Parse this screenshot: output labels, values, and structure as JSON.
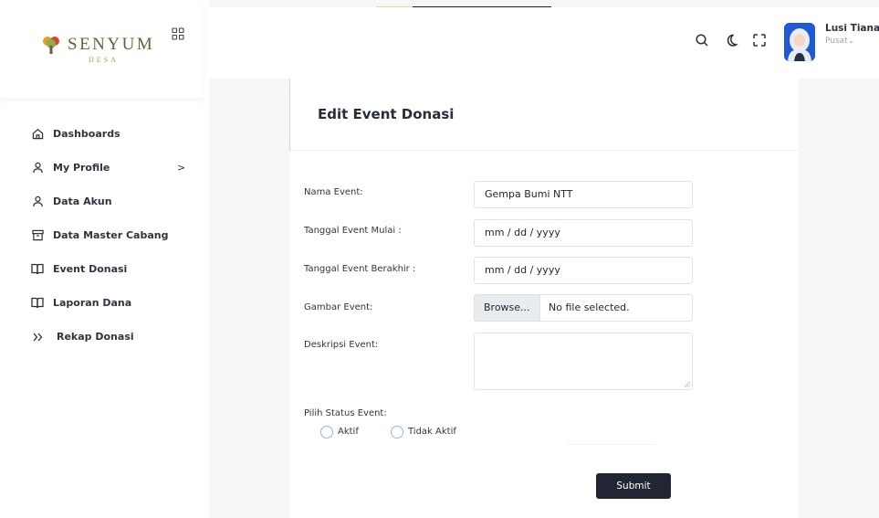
{
  "brand": {
    "name": "SENYUM",
    "tagline": "DESA"
  },
  "sidebar": {
    "items": [
      {
        "label": "Dashboards",
        "icon": "home-icon"
      },
      {
        "label": "My Profile",
        "icon": "user-icon",
        "chevron": ">"
      },
      {
        "label": "Data Akun",
        "icon": "user-icon"
      },
      {
        "label": "Data Master Cabang",
        "icon": "archive-icon"
      },
      {
        "label": "Event Donasi",
        "icon": "book-open-icon"
      },
      {
        "label": "Laporan Dana",
        "icon": "book-open-icon"
      },
      {
        "label": "Rekap Donasi",
        "icon": "double-chevron-right-icon"
      }
    ]
  },
  "header": {
    "icons": [
      "search-icon",
      "moon-icon",
      "fullscreen-icon"
    ],
    "user": {
      "name": "Lusi Tiana",
      "role": "Pusat",
      "role_caret": "⌄"
    }
  },
  "form": {
    "title": "Edit Event Donasi",
    "fields": {
      "nama_event": {
        "label": "Nama Event:",
        "value": "Gempa Bumi NTT"
      },
      "tanggal_mulai": {
        "label": "Tanggal Event Mulai :",
        "value": "mm / dd / yyyy"
      },
      "tanggal_berakhir": {
        "label": "Tanggal Event Berakhir :",
        "value": "mm / dd / yyyy"
      },
      "gambar": {
        "label": "Gambar Event:",
        "button": "Browse...",
        "status": "No file selected."
      },
      "deskripsi": {
        "label": "Deskripsi Event:",
        "value": ""
      }
    },
    "status": {
      "label": "Pilih Status Event:",
      "options": [
        "Aktif",
        "Tidak Aktif"
      ]
    },
    "submit_label": "Submit"
  },
  "colors": {
    "sidebar_bg": "#ffffff",
    "page_bg": "#f6f6f7",
    "button_dark": "#222634",
    "radio_border": "#8fb5ea",
    "brand_text": "#6d5d3d",
    "brand_green": "#8bab54",
    "avatar_bg": "#1f5ad6"
  }
}
